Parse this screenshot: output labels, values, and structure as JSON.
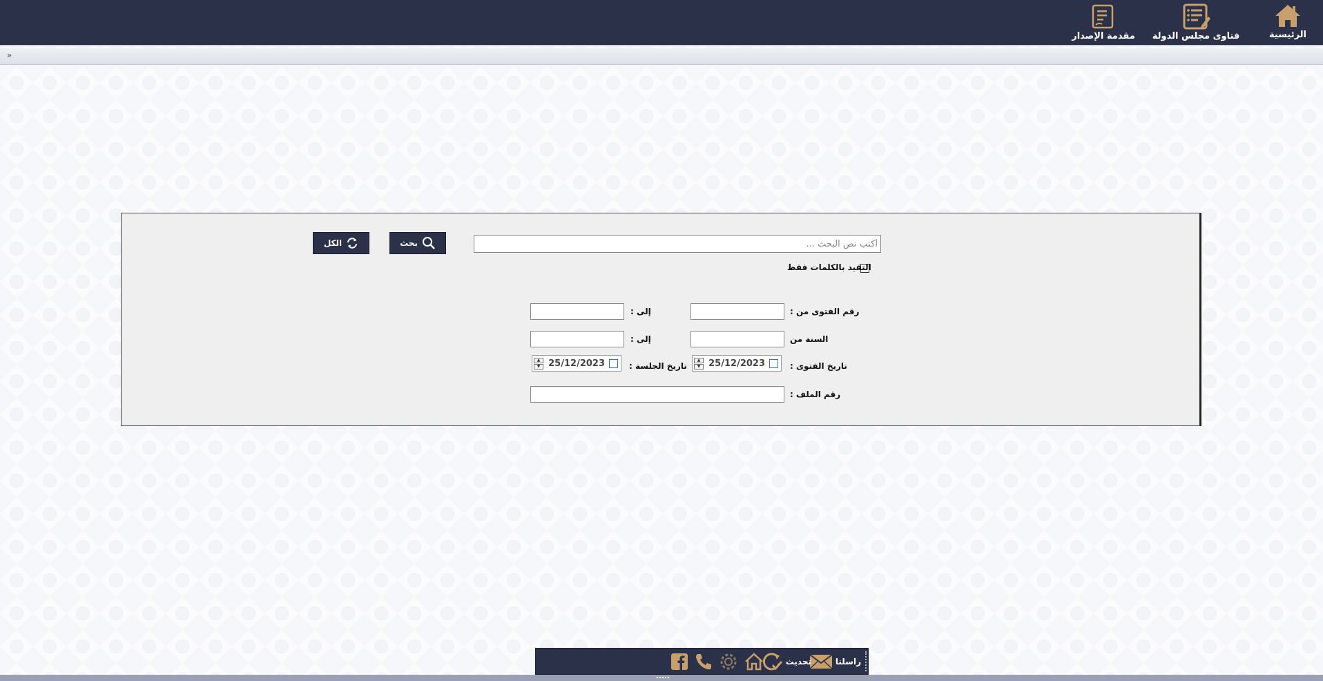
{
  "nav": {
    "home_label": "الرئيسية",
    "fatawa_label": "فتاوى مجلس الدولة",
    "intro_label": "مقدمة الإصدار"
  },
  "subbar": {
    "collapse_glyph": "»"
  },
  "search": {
    "placeholder": "أكتب نص البحث ...",
    "value": "",
    "search_button_label": "بحث",
    "all_button_label": "الكل",
    "exact_words_label": "التقيد بالكلمات فقط",
    "exact_words_checked": false
  },
  "filters": {
    "fatwa_number_from_label": "رقم الفتوى من :",
    "fatwa_number_to_label": "إلى :",
    "year_from_label": "السنة من",
    "year_to_label": "إلى :",
    "fatwa_date_label": "تاريخ الفتوى :",
    "fatwa_date_value": "25/12/2023",
    "session_date_label": "تاريخ الجلسة :",
    "session_date_value": "25/12/2023",
    "file_number_label": "رقم الملف :"
  },
  "bottombar": {
    "contact_label": "راسلنا",
    "refresh_label": "تحديث"
  },
  "colors": {
    "navy": "#2b3149",
    "gold": "#c9a06b",
    "panel": "#efefef"
  }
}
